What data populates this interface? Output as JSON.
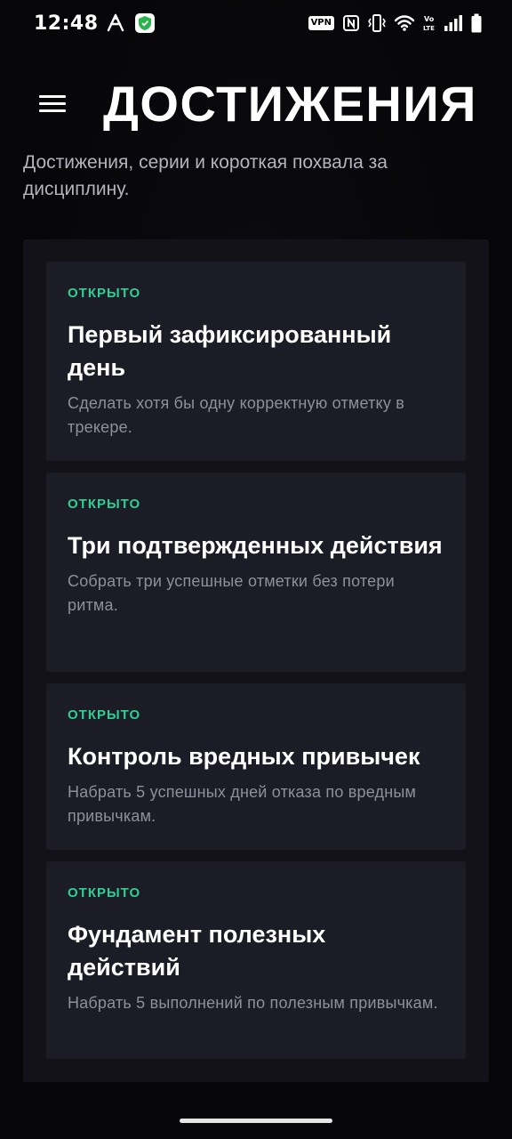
{
  "status_bar": {
    "time": "12:48",
    "vpn_label": "VPN",
    "icons": [
      "accessibility-icon",
      "shield-icon",
      "nfc-icon",
      "vibrate-icon",
      "wifi-icon",
      "volte-icon",
      "signal-icon",
      "battery-icon"
    ]
  },
  "header": {
    "title": "ДОСТИЖЕНИЯ",
    "menu_icon": "hamburger-menu-icon"
  },
  "subtitle": "Достижения, серии и короткая похвала за дисциплину.",
  "colors": {
    "background": "#07070a",
    "panel": "#121218",
    "card": "#1c1c26",
    "status_accent": "#2fcf93",
    "description_text": "#8f8f9c"
  },
  "achievements": [
    {
      "status": "ОТКРЫТО",
      "title": "Первый зафиксированный день",
      "description": "Сделать хотя бы одну корректную отметку в трекере."
    },
    {
      "status": "ОТКРЫТО",
      "title": "Три подтвержденных действия",
      "description": "Собрать три успешные отметки без потери ритма."
    },
    {
      "status": "ОТКРЫТО",
      "title": "Контроль вредных привычек",
      "description": "Набрать 5 успешных дней отказа по вредным привычкам."
    },
    {
      "status": "ОТКРЫТО",
      "title": "Фундамент полезных действий",
      "description": "Набрать 5 выполнений по полезным привычкам."
    }
  ]
}
